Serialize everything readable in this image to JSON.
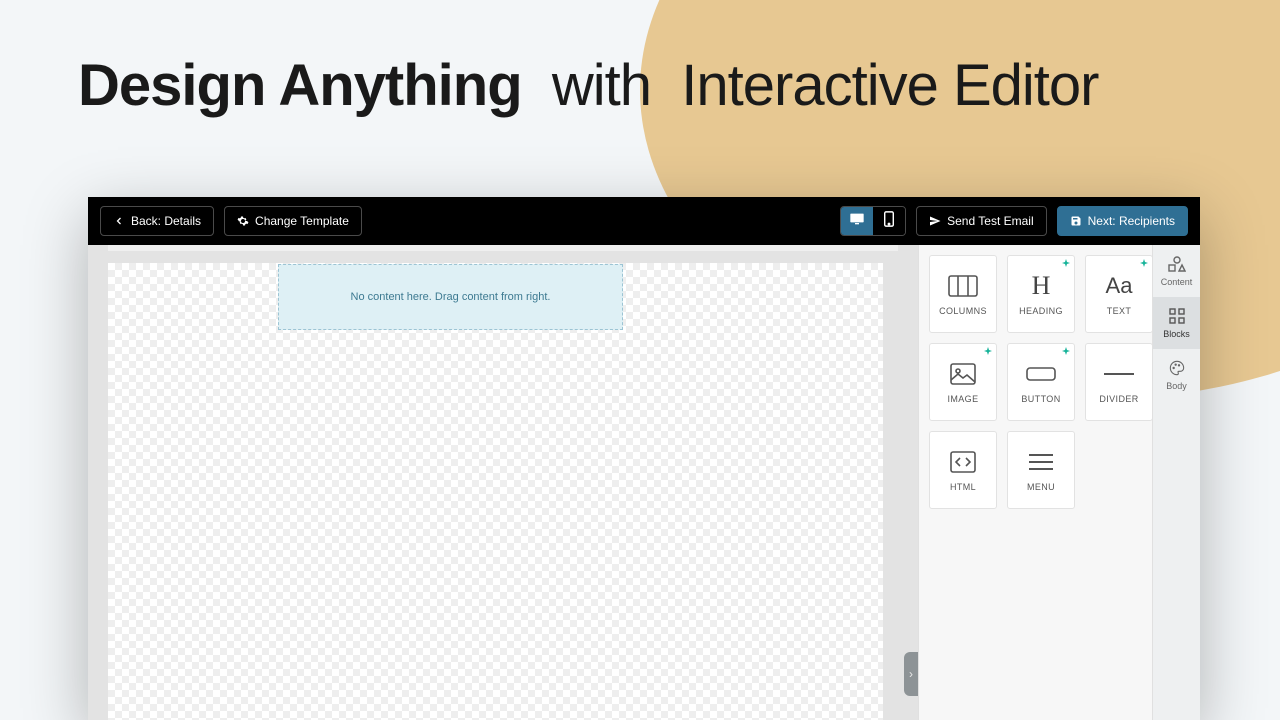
{
  "hero": {
    "bold": "Design Anything",
    "light_with": "with",
    "light_rest": "Interactive Editor"
  },
  "topbar": {
    "back_label": "Back: Details",
    "change_template_label": "Change Template",
    "send_test_label": "Send Test Email",
    "next_label": "Next: Recipients"
  },
  "canvas": {
    "empty_message": "No content here. Drag content from right."
  },
  "blocks": {
    "columns": "COLUMNS",
    "heading": "HEADING",
    "text": "TEXT",
    "image": "IMAGE",
    "button": "BUTTON",
    "divider": "DIVIDER",
    "html": "HTML",
    "menu": "MENU"
  },
  "rail": {
    "content": "Content",
    "blocks": "Blocks",
    "body": "Body"
  }
}
